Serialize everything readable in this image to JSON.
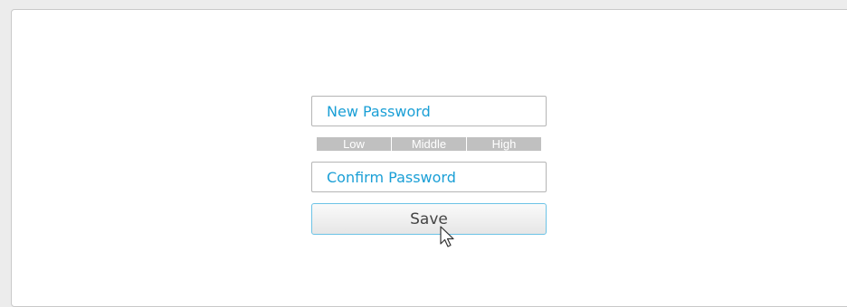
{
  "form": {
    "new_password_placeholder": "New Password",
    "confirm_password_placeholder": "Confirm Password",
    "strength_levels": [
      "Low",
      "Middle",
      "High"
    ],
    "save_label": "Save"
  },
  "colors": {
    "accent": "#1a9fd6",
    "strength_bar": "#c0c0c0",
    "button_border": "#6cc3e6"
  },
  "icons": {
    "cursor": "arrow-cursor-icon"
  }
}
